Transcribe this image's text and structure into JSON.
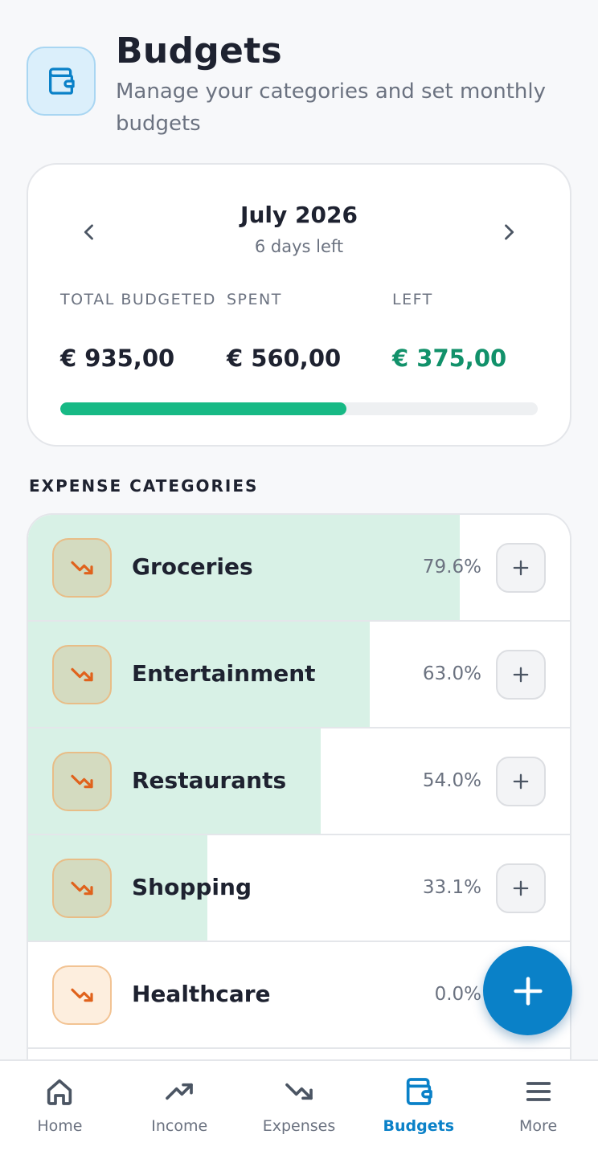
{
  "header": {
    "icon": "wallet-icon",
    "title": "Budgets",
    "subtitle": "Manage your categories and set monthly budgets"
  },
  "summary": {
    "prev_icon": "chevron-left-icon",
    "next_icon": "chevron-right-icon",
    "month": "July 2026",
    "days_left": "6 days left",
    "stats": [
      {
        "label": "TOTAL BUDGETED",
        "value": "€ 935,00"
      },
      {
        "label": "SPENT",
        "value": "€ 560,00"
      },
      {
        "label": "LEFT",
        "value": "€ 375,00",
        "color": "#11916a"
      }
    ],
    "progress_fraction": 0.599,
    "progress_color": "#17b985"
  },
  "section_title": "EXPENSE CATEGORIES",
  "categories": [
    {
      "name": "Groceries",
      "percent": "79.6%",
      "fill_fraction": 0.796,
      "icon": "trending-down-icon"
    },
    {
      "name": "Entertainment",
      "percent": "63.0%",
      "fill_fraction": 0.63,
      "icon": "trending-down-icon"
    },
    {
      "name": "Restaurants",
      "percent": "54.0%",
      "fill_fraction": 0.54,
      "icon": "trending-down-icon"
    },
    {
      "name": "Shopping",
      "percent": "33.1%",
      "fill_fraction": 0.331,
      "icon": "trending-down-icon"
    },
    {
      "name": "Healthcare",
      "percent": "0.0%",
      "fill_fraction": 0.0,
      "icon": "trending-down-icon"
    }
  ],
  "fab_icon": "plus-icon",
  "bottom_nav": [
    {
      "label": "Home",
      "icon": "home-icon",
      "active": false
    },
    {
      "label": "Income",
      "icon": "trending-up-icon",
      "active": false
    },
    {
      "label": "Expenses",
      "icon": "trending-down-icon",
      "active": false
    },
    {
      "label": "Budgets",
      "icon": "wallet-icon",
      "active": true
    },
    {
      "label": "More",
      "icon": "menu-icon",
      "active": false
    }
  ],
  "colors": {
    "accent": "#0a81c8",
    "fill": "#d8f1e6",
    "expense_icon": "#e0621c"
  }
}
